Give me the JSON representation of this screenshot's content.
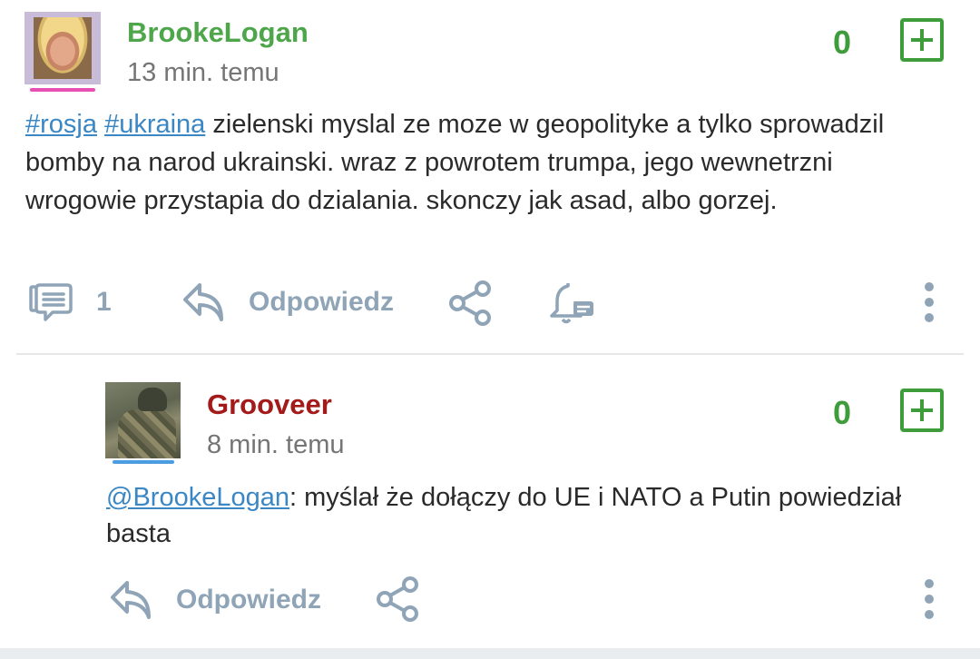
{
  "post": {
    "username": "BrookeLogan",
    "time": "13 min. temu",
    "score": "0",
    "tags": [
      "#rosja",
      "#ukraina"
    ],
    "text": " zielenski myslal ze moze w geopolityke a tylko sprowadzil bomby na narod ukrainski. wraz z powrotem trumpa, jego wewnetrzni wrogowie przystapia do dzialania. skonczy jak asad, albo gorzej.",
    "comment_count": "1",
    "reply_label": "Odpowiedz",
    "username_color": "#4ea64a",
    "avatar_underline_color": "#e84fb3"
  },
  "reply": {
    "username": "Grooveer",
    "time": "8 min. temu",
    "score": "0",
    "mention": "@BrookeLogan",
    "text": ": myślał że dołączy do UE i NATO a Putin powiedział basta",
    "reply_label": "Odpowiedz",
    "username_color": "#a31a1a",
    "avatar_underline_color": "#4a9ee0"
  },
  "icons": {
    "comments": "comments-icon",
    "reply": "reply-arrow-icon",
    "share": "share-icon",
    "notify": "bell-icon",
    "more": "more-vertical-icon",
    "upvote": "plus-icon"
  },
  "colors": {
    "accent_green": "#3f9c3b",
    "link": "#3b87c4",
    "muted_action": "#8fa4b6"
  }
}
